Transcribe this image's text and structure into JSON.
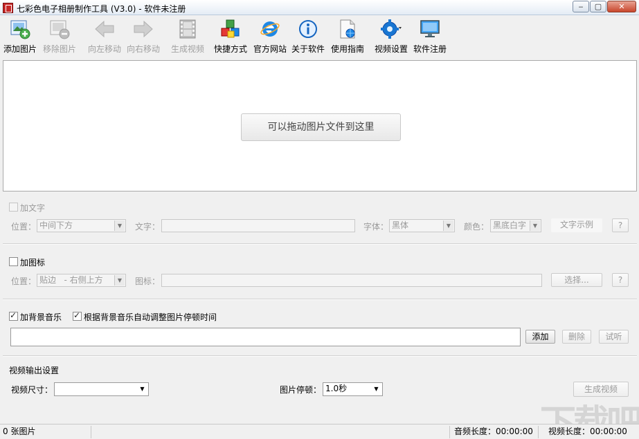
{
  "window": {
    "title": "七彩色电子相册制作工具 (V3.0) - 软件未注册",
    "min_glyph": "‒",
    "max_glyph": "▢",
    "close_glyph": "✕"
  },
  "toolbar": {
    "add_image": "添加图片",
    "remove_image": "移除图片",
    "move_left": "向左移动",
    "move_right": "向右移动",
    "generate_video": "生成视频",
    "shortcut": "快捷方式",
    "official_site": "官方网站",
    "about": "关于软件",
    "guide": "使用指南",
    "video_settings": "视频设置",
    "register": "软件注册"
  },
  "drop_area": {
    "hint": "可以拖动图片文件到这里"
  },
  "text_section": {
    "checkbox_label": "加文字",
    "position_label": "位置：",
    "position_value": "中间下方",
    "text_label": "文字：",
    "font_label": "字体：",
    "font_value": "黑体",
    "color_label": "颜色：",
    "color_value": "黑底白字",
    "sample_button": "文字示例",
    "help_button": "?"
  },
  "icon_section": {
    "checkbox_label": "加图标",
    "position_label": "位置：",
    "position_value": "贴边   - 右侧上方",
    "icon_label": "图标：",
    "select_button": "选择...",
    "help_button": "?"
  },
  "music_section": {
    "bg_music_label": "加背景音乐",
    "auto_adjust_label": "根据背景音乐自动调整图片停顿时间",
    "bg_music_checked": true,
    "auto_adjust_checked": true,
    "add_button": "添加",
    "delete_button": "删除",
    "preview_button": "试听"
  },
  "output_section": {
    "heading": "视频输出设置",
    "size_label": "视频尺寸：",
    "size_value": "",
    "pause_label": "图片停顿：",
    "pause_value": "1.0秒",
    "generate_button": "生成视频"
  },
  "status": {
    "image_count": "0 张图片",
    "audio_length_label": "音频长度：",
    "audio_length": "00:00:00",
    "video_length_label": "视频长度：",
    "video_length": "00:00:00"
  },
  "watermark": "下载吧",
  "colors": {
    "accent_blue": "#2b6cc4",
    "close_red": "#c9462c",
    "brand_red": "#c62828"
  }
}
